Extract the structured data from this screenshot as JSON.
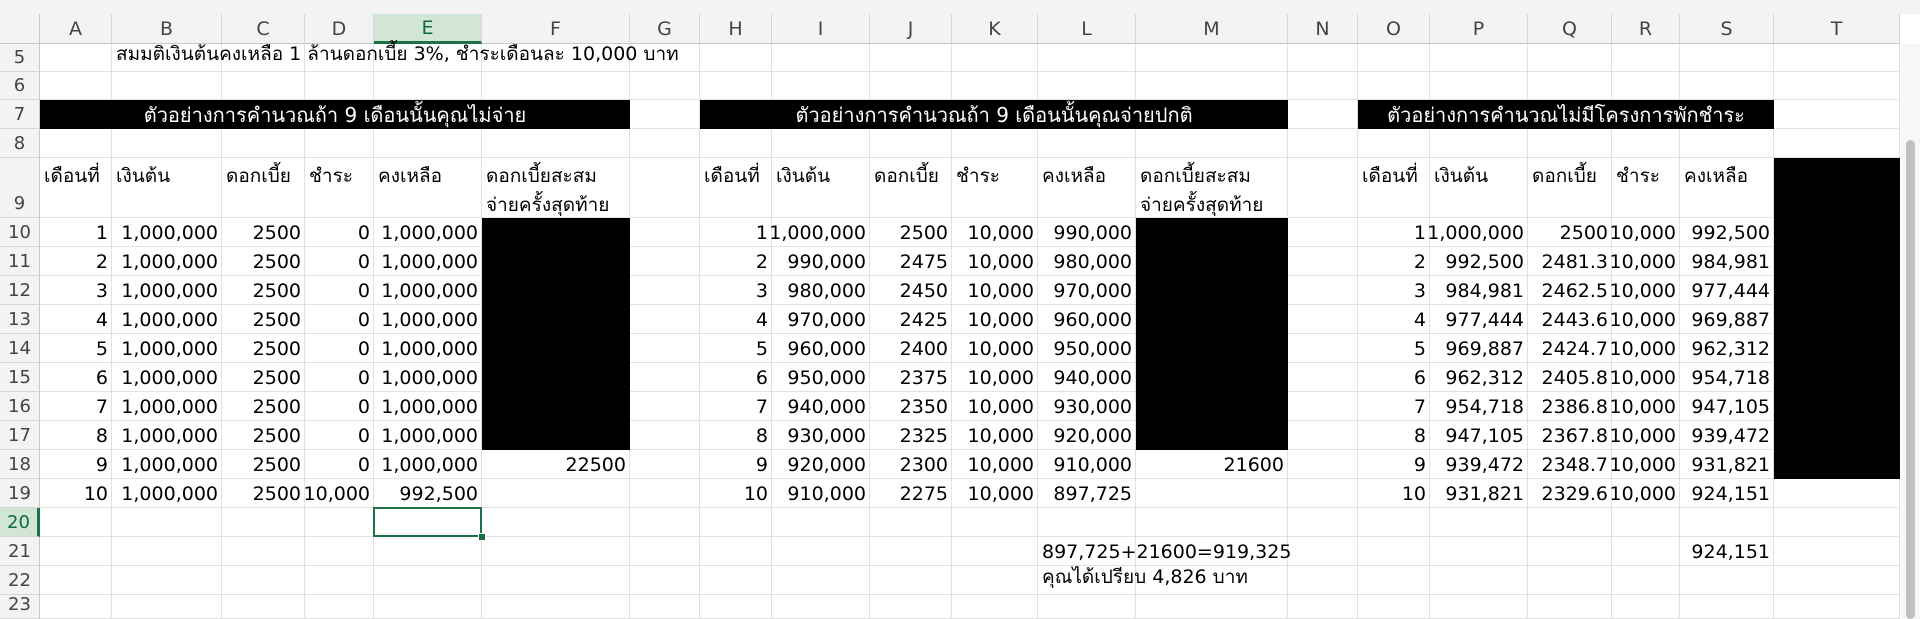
{
  "columns": [
    "A",
    "B",
    "C",
    "D",
    "E",
    "F",
    "G",
    "H",
    "I",
    "J",
    "K",
    "L",
    "M",
    "N",
    "O",
    "P",
    "Q",
    "R",
    "S",
    "T"
  ],
  "selected_column": "E",
  "rows": [
    "5",
    "6",
    "7",
    "8",
    "9",
    "10",
    "11",
    "12",
    "13",
    "14",
    "15",
    "16",
    "17",
    "18",
    "19",
    "20",
    "21",
    "22",
    "23"
  ],
  "selected_row": "20",
  "assumption": "สมมติเงินต้นคงเหลือ 1 ล้านดอกเบี้ย 3%, ชำระเดือนละ 10,000 บาท",
  "titles": {
    "skip": "ตัวอย่างการคำนวณถ้า 9 เดือนนั้นคุณไม่จ่าย",
    "normal": "ตัวอย่างการคำนวณถ้า 9 เดือนนั้นคุณจ่ายปกติ",
    "none": "ตัวอย่างการคำนวณไม่มีโครงการพักชำระ"
  },
  "headers": {
    "month": "เดือนที่",
    "principal": "เงินต้น",
    "interest": "ดอกเบี้ย",
    "payment": "ชำระ",
    "balance": "คงเหลือ",
    "accrued": "ดอกเบี้ยสะสม จ่ายครั้งสุดท้าย"
  },
  "table1": [
    [
      "1",
      "1,000,000",
      "2500",
      "0",
      "1,000,000"
    ],
    [
      "2",
      "1,000,000",
      "2500",
      "0",
      "1,000,000"
    ],
    [
      "3",
      "1,000,000",
      "2500",
      "0",
      "1,000,000"
    ],
    [
      "4",
      "1,000,000",
      "2500",
      "0",
      "1,000,000"
    ],
    [
      "5",
      "1,000,000",
      "2500",
      "0",
      "1,000,000"
    ],
    [
      "6",
      "1,000,000",
      "2500",
      "0",
      "1,000,000"
    ],
    [
      "7",
      "1,000,000",
      "2500",
      "0",
      "1,000,000"
    ],
    [
      "8",
      "1,000,000",
      "2500",
      "0",
      "1,000,000"
    ],
    [
      "9",
      "1,000,000",
      "2500",
      "0",
      "1,000,000"
    ],
    [
      "10",
      "1,000,000",
      "2500",
      "10,000",
      "992,500"
    ]
  ],
  "table1_accrued": "22500",
  "table2": [
    [
      "1",
      "1,000,000",
      "2500",
      "10,000",
      "990,000"
    ],
    [
      "2",
      "990,000",
      "2475",
      "10,000",
      "980,000"
    ],
    [
      "3",
      "980,000",
      "2450",
      "10,000",
      "970,000"
    ],
    [
      "4",
      "970,000",
      "2425",
      "10,000",
      "960,000"
    ],
    [
      "5",
      "960,000",
      "2400",
      "10,000",
      "950,000"
    ],
    [
      "6",
      "950,000",
      "2375",
      "10,000",
      "940,000"
    ],
    [
      "7",
      "940,000",
      "2350",
      "10,000",
      "930,000"
    ],
    [
      "8",
      "930,000",
      "2325",
      "10,000",
      "920,000"
    ],
    [
      "9",
      "920,000",
      "2300",
      "10,000",
      "910,000"
    ],
    [
      "10",
      "910,000",
      "2275",
      "10,000",
      "897,725"
    ]
  ],
  "table2_accrued": "21600",
  "table3": [
    [
      "1",
      "1,000,000",
      "2500",
      "10,000",
      "992,500"
    ],
    [
      "2",
      "992,500",
      "2481.3",
      "10,000",
      "984,981"
    ],
    [
      "3",
      "984,981",
      "2462.5",
      "10,000",
      "977,444"
    ],
    [
      "4",
      "977,444",
      "2443.6",
      "10,000",
      "969,887"
    ],
    [
      "5",
      "969,887",
      "2424.7",
      "10,000",
      "962,312"
    ],
    [
      "6",
      "962,312",
      "2405.8",
      "10,000",
      "954,718"
    ],
    [
      "7",
      "954,718",
      "2386.8",
      "10,000",
      "947,105"
    ],
    [
      "8",
      "947,105",
      "2367.8",
      "10,000",
      "939,472"
    ],
    [
      "9",
      "939,472",
      "2348.7",
      "10,000",
      "931,821"
    ],
    [
      "10",
      "931,821",
      "2329.6",
      "10,000",
      "924,151"
    ]
  ],
  "summary_formula": "897,725+21600=919,325",
  "summary_benefit": "คุณได้เปรียบ 4,826 บาท",
  "summary_none": "924,151"
}
